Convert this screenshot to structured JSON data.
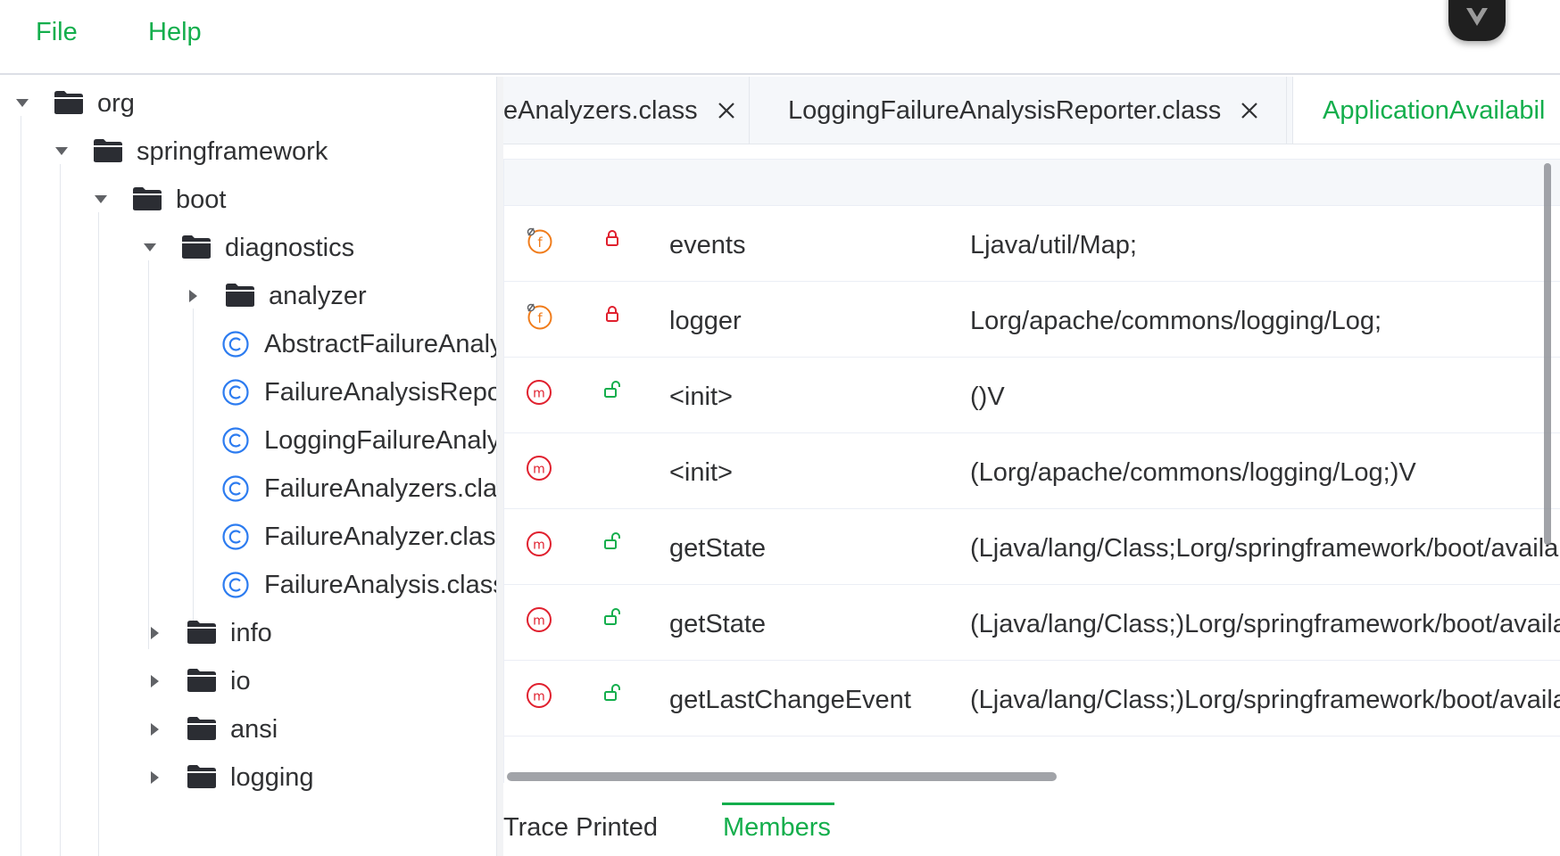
{
  "menu": {
    "file": "File",
    "help": "Help"
  },
  "tree": {
    "org": "org",
    "springframework": "springframework",
    "boot": "boot",
    "diagnostics": "diagnostics",
    "analyzer": "analyzer",
    "class1": "AbstractFailureAnalyzer.class",
    "class2": "FailureAnalysisReporter.class",
    "class3": "LoggingFailureAnalysisReporter.class",
    "class4": "FailureAnalyzers.class",
    "class5": "FailureAnalyzer.class",
    "class6": "FailureAnalysis.class",
    "info": "info",
    "io": "io",
    "ansi": "ansi",
    "logging": "logging"
  },
  "tabs": {
    "tab1": "eAnalyzers.class",
    "tab2": "LoggingFailureAnalysisReporter.class",
    "tab3": "ApplicationAvailabil"
  },
  "members": [
    {
      "kind": "f",
      "access": "private",
      "name": "events",
      "descriptor": "Ljava/util/Map;"
    },
    {
      "kind": "f",
      "access": "private",
      "name": "logger",
      "descriptor": "Lorg/apache/commons/logging/Log;"
    },
    {
      "kind": "m",
      "access": "public",
      "name": "<init>",
      "descriptor": "()V"
    },
    {
      "kind": "m",
      "access": "package",
      "name": "<init>",
      "descriptor": "(Lorg/apache/commons/logging/Log;)V"
    },
    {
      "kind": "m",
      "access": "public",
      "name": "getState",
      "descriptor": "(Ljava/lang/Class;Lorg/springframework/boot/availability/AvailabilityState;)Lorg/springframework/boot/availability/AvailabilityState;"
    },
    {
      "kind": "m",
      "access": "public",
      "name": "getState",
      "descriptor": "(Ljava/lang/Class;)Lorg/springframework/boot/availability/AvailabilityState;"
    },
    {
      "kind": "m",
      "access": "public",
      "name": "getLastChangeEvent",
      "descriptor": "(Ljava/lang/Class;)Lorg/springframework/boot/availability/AvailabilityChangeEvent;"
    }
  ],
  "bottom_tabs": {
    "trace": "Trace Printed",
    "members": "Members"
  },
  "colors": {
    "accent": "#13ae4c",
    "field_icon": "#f07c1b",
    "method_icon": "#e0202e",
    "lock_private": "#e0202e",
    "lock_public": "#13ae4c",
    "class_icon": "#2d7cf0"
  }
}
